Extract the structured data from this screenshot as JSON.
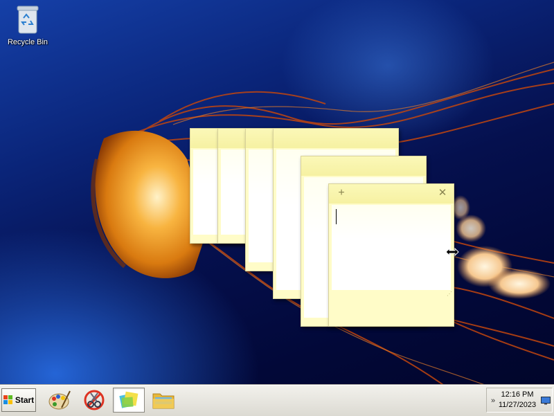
{
  "desktop": {
    "icons": [
      {
        "label": "Recycle Bin",
        "icon": "recycle-bin-icon"
      }
    ]
  },
  "sticky_notes": {
    "new_note_symbol": "+",
    "close_symbol": "✕",
    "grip_symbol": "⋰",
    "count": 6
  },
  "taskbar": {
    "start_label": "Start",
    "pinned": [
      {
        "name": "paint",
        "icon": "paint-palette-icon"
      },
      {
        "name": "snipping-tool",
        "icon": "scissors-icon"
      },
      {
        "name": "sticky-notes",
        "icon": "sticky-notes-icon",
        "active": true
      },
      {
        "name": "file-explorer",
        "icon": "folder-icon"
      }
    ],
    "tray": {
      "expand_symbol": "»",
      "time": "12:16 PM",
      "date": "11/27/2023"
    }
  },
  "colors": {
    "note_body": "#fffcc8",
    "note_header": "#f6f1a2",
    "taskbar": "#dcdad2"
  }
}
